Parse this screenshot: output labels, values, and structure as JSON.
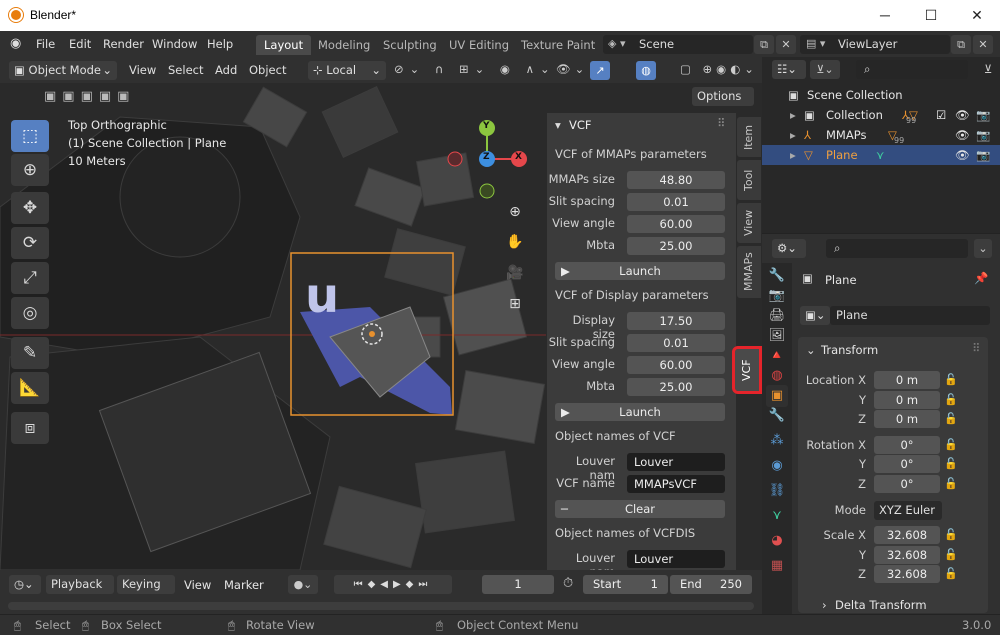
{
  "window": {
    "title": "Blender*",
    "minimize": "─",
    "maximize": "☐",
    "close": "✕"
  },
  "topbar": {
    "menus": [
      "File",
      "Edit",
      "Render",
      "Window",
      "Help"
    ],
    "workspaces": [
      "Layout",
      "Modeling",
      "Sculpting",
      "UV Editing",
      "Texture Paint"
    ],
    "active_workspace": "Layout",
    "scene": "Scene",
    "view_layer": "ViewLayer"
  },
  "viewport": {
    "mode": "Object Mode",
    "menus": [
      "View",
      "Select",
      "Add",
      "Object"
    ],
    "orientation": "Local",
    "options": "Options",
    "overlay_lines": [
      "Top Orthographic",
      "(1) Scene Collection | Plane",
      "10 Meters"
    ],
    "gizmo": {
      "x": "X",
      "y": "Y",
      "z": "Z"
    }
  },
  "npanel": {
    "header": "VCF",
    "section1_title": "VCF of MMAPs parameters",
    "section1": [
      {
        "label": "MMAPs size",
        "value": "48.80"
      },
      {
        "label": "Slit spacing",
        "value": "0.01"
      },
      {
        "label": "View angle",
        "value": "60.00"
      },
      {
        "label": "Mbta",
        "value": "25.00"
      }
    ],
    "launch1": "Launch",
    "section2_title": "VCF of Display parameters",
    "section2": [
      {
        "label": "Display size",
        "value": "17.50"
      },
      {
        "label": "Slit spacing",
        "value": "0.01"
      },
      {
        "label": "View angle",
        "value": "60.00"
      },
      {
        "label": "Mbta",
        "value": "25.00"
      }
    ],
    "launch2": "Launch",
    "section3_title": "Object names of VCF",
    "section3": [
      {
        "label": "Louver nam",
        "value": "Louver"
      },
      {
        "label": "VCF name",
        "value": "MMAPsVCF"
      }
    ],
    "clear": "Clear",
    "section4_title": "Object names of VCFDIS",
    "section4": [
      {
        "label": "Louver nam",
        "value": "Louver"
      }
    ]
  },
  "sidebar_tabs": [
    "Item",
    "Tool",
    "View",
    "MMAPs",
    "VCF"
  ],
  "active_tab": "VCF",
  "timeline": {
    "menus": [
      "Playback",
      "Keying",
      "View",
      "Marker"
    ],
    "current_frame": "1",
    "start_label": "Start",
    "start": "1",
    "end_label": "End",
    "end": "250"
  },
  "statusbar": {
    "select": "Select",
    "box_select": "Box Select",
    "rotate_view": "Rotate View",
    "context_menu": "Object Context Menu",
    "version": "3.0.0"
  },
  "outliner": {
    "rows": [
      {
        "label": "Scene Collection"
      },
      {
        "label": "Collection",
        "count": "99"
      },
      {
        "label": "MMAPs",
        "count": "99"
      },
      {
        "label": "Plane"
      }
    ]
  },
  "properties": {
    "object": "Plane",
    "data": "Plane",
    "section": "Transform",
    "location": {
      "label": "Location X",
      "x": "0 m",
      "y": "0 m",
      "z": "0 m"
    },
    "rotation": {
      "label": "Rotation X",
      "x": "0°",
      "y": "0°",
      "z": "0°"
    },
    "mode_label": "Mode",
    "mode": "XYZ Euler",
    "scale": {
      "label": "Scale X",
      "x": "32.608",
      "y": "32.608",
      "z": "32.608"
    },
    "axis_y": "Y",
    "axis_z": "Z",
    "delta": "Delta Transform"
  },
  "colors": {
    "accent": "#5680c2",
    "highlight": "#e5242b",
    "plane": "#4c56a8",
    "selected_outline": "#e8912e"
  }
}
